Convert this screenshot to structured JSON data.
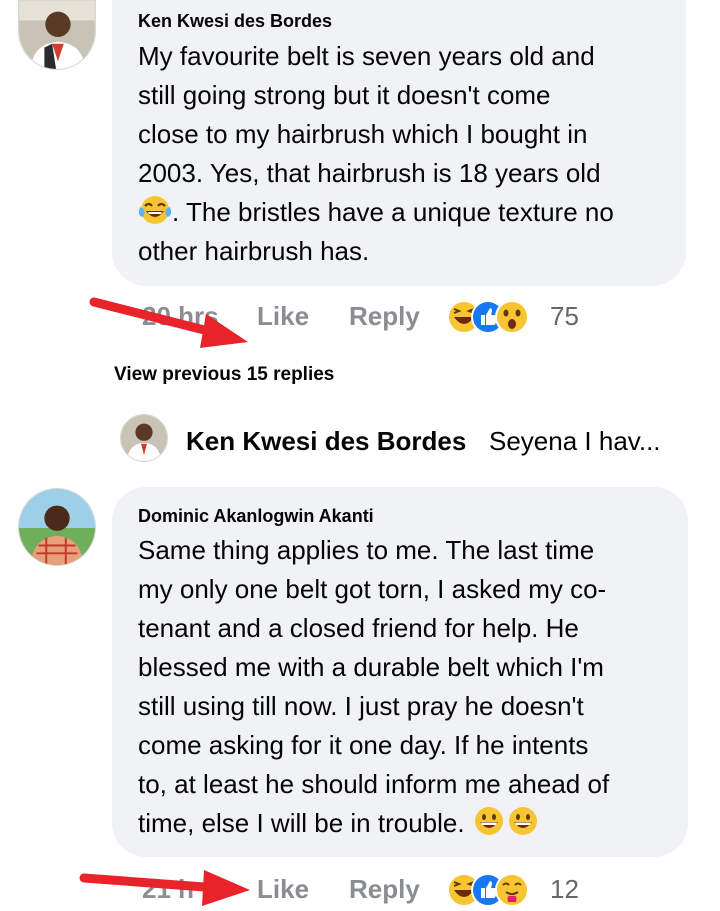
{
  "comments": [
    {
      "author": "Ken Kwesi des Bordes",
      "lines": [
        "My favourite belt is seven years old and",
        "still going strong but it doesn't come",
        "close to my hairbrush which I bought in",
        "2003. Yes, that hairbrush is 18 years old",
        ". The bristles have a unique texture no",
        "other hairbrush has."
      ],
      "timestamp": "20 hrs",
      "like_label": "Like",
      "reply_label": "Reply",
      "reaction_count": "75",
      "reactions": [
        "laughing-emoji",
        "like-icon",
        "wow-emoji"
      ]
    },
    {
      "author": "Dominic Akanlogwin Akanti",
      "lines": [
        "Same thing applies  to me. The last time",
        "my only one belt got torn, I asked my co-",
        "tenant and a closed friend for help. He",
        "blessed me with a durable belt which I'm",
        "still  using till now.  I just pray he  doesn't",
        "come asking for it one day. If he intents",
        "to, at least he should inform me ahead of",
        "time, else I will be in trouble."
      ],
      "timestamp": "21 h",
      "like_label": "Like",
      "reply_label": "Reply",
      "reaction_count": "12",
      "reactions": [
        "laughing-emoji",
        "like-icon",
        "care-emoji"
      ]
    }
  ],
  "view_previous": "View previous 15 replies",
  "reply_preview": {
    "author": "Ken Kwesi des Bordes",
    "snippet": "Seyena I hav..."
  },
  "colors": {
    "bubble": "#f0f2f5",
    "action_text": "#8a8d91",
    "like_blue": "#1877f2",
    "emoji_yellow": "#f7c531",
    "annotation_red": "#e8232a"
  }
}
